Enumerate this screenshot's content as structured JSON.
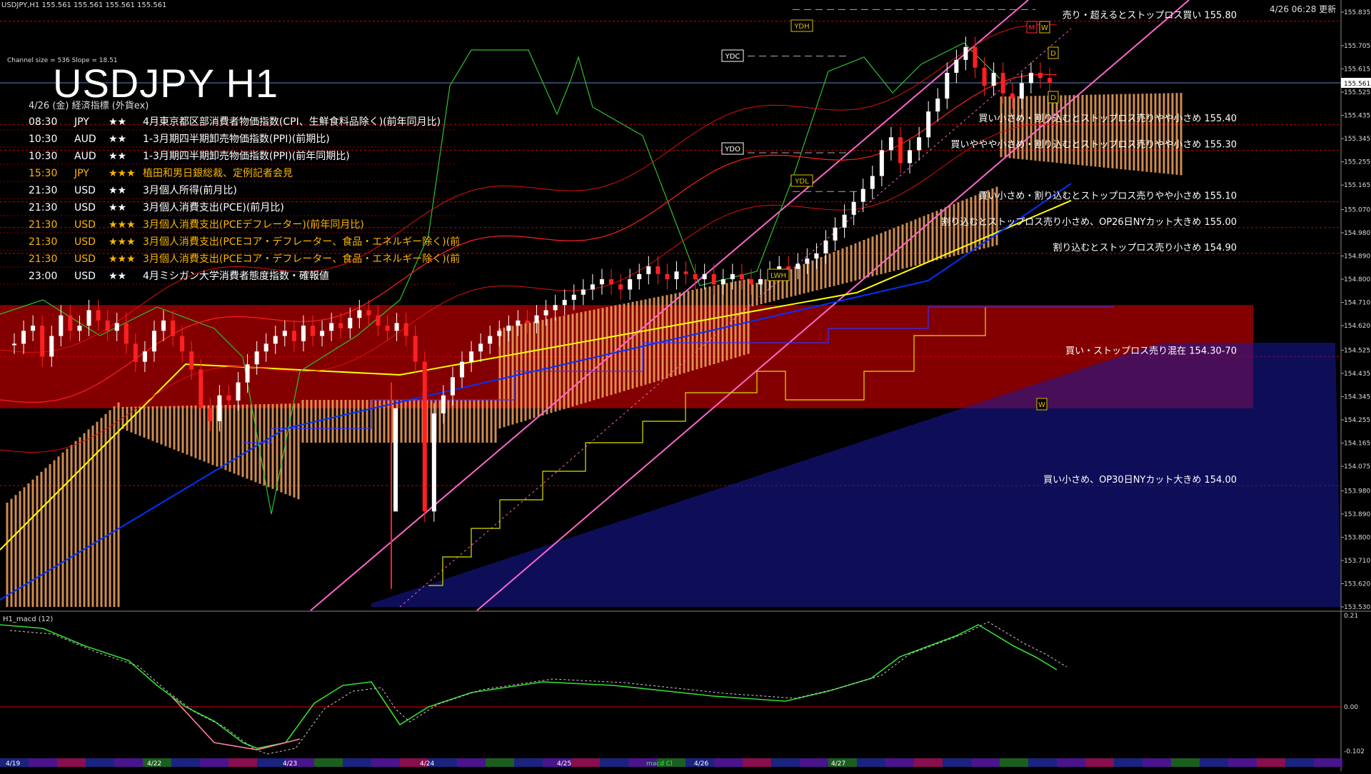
{
  "header": {
    "symbol_line": "USDJPY,H1  155.561 155.561 155.561 155.561",
    "updated": "4/26 06:28 更新"
  },
  "channel_info": "Channel size = 536 Slope = 18.51",
  "title": "USDJPY H1",
  "date_header": "4/26 (金) 経済指標 (外貨ex)",
  "events": [
    {
      "time": "08:30",
      "ccy": "JPY",
      "stars": "★★",
      "text": "4月東京都区部消費者物価指数(CPI、生鮮食料品除く)(前年同月比)",
      "color": "#ffffff"
    },
    {
      "time": "10:30",
      "ccy": "AUD",
      "stars": "★★",
      "text": "1-3月期四半期卸売物価指数(PPI)(前期比)",
      "color": "#ffffff"
    },
    {
      "time": "10:30",
      "ccy": "AUD",
      "stars": "★★",
      "text": "1-3月期四半期卸売物価指数(PPI)(前年同期比)",
      "color": "#ffffff"
    },
    {
      "time": "15:30",
      "ccy": "JPY",
      "stars": "★★★",
      "text": "植田和男日銀総裁、定例記者会見",
      "color": "#ffb400"
    },
    {
      "time": "21:30",
      "ccy": "USD",
      "stars": "★★",
      "text": "3月個人所得(前月比)",
      "color": "#ffffff"
    },
    {
      "time": "21:30",
      "ccy": "USD",
      "stars": "★★",
      "text": "3月個人消費支出(PCE)(前月比)",
      "color": "#ffffff"
    },
    {
      "time": "21:30",
      "ccy": "USD",
      "stars": "★★★",
      "text": "3月個人消費支出(PCEデフレーター)(前年同月比)",
      "color": "#ffb400"
    },
    {
      "time": "21:30",
      "ccy": "USD",
      "stars": "★★★",
      "text": "3月個人消費支出(PCEコア・デフレーター、食品・エネルギー除く)(前",
      "color": "#ffb400"
    },
    {
      "time": "21:30",
      "ccy": "USD",
      "stars": "★★★",
      "text": "3月個人消費支出(PCEコア・デフレーター、食品・エネルギー除く)(前",
      "color": "#ffb400"
    },
    {
      "time": "23:00",
      "ccy": "USD",
      "stars": "★★",
      "text": "4月ミシガン大学消費者態度指数・確報値",
      "color": "#ffffff"
    }
  ],
  "orders": [
    {
      "text": "売り・超えるとストップロス買い 155.80",
      "price": 155.8
    },
    {
      "text": "買い小さめ・割り込むとストップロス売りやや小さめ 155.40",
      "price": 155.4
    },
    {
      "text": "買いややや小さめ・割り込むとストップロス売りやや小さめ 155.30",
      "price": 155.3
    },
    {
      "text": "買い小さめ・割り込むとストップロス売りやや小さめ 155.10",
      "price": 155.1
    },
    {
      "text": "割り込むとストップロス売り小さめ、OP26日NYカット大きめ 155.00",
      "price": 155.0
    },
    {
      "text": "割り込むとストップロス売り小さめ 154.90",
      "price": 154.9
    },
    {
      "text": "買い・ストップロス売り混在 154.30-70",
      "price": 154.5
    },
    {
      "text": "買い小さめ、OP30日NYカット大きめ 154.00",
      "price": 154.0
    }
  ],
  "level_tags": [
    {
      "text": "YDH",
      "price": 155.845
    },
    {
      "text": "YDC",
      "price": 155.665
    },
    {
      "text": "YDO",
      "price": 155.29
    },
    {
      "text": "YDL",
      "price": 155.14
    },
    {
      "text": "LWH",
      "price": 154.83
    },
    {
      "text": "M",
      "price": 155.84
    },
    {
      "text": "W",
      "price": 155.84
    },
    {
      "text": "D",
      "price": 155.665
    },
    {
      "text": "D",
      "price": 155.5
    },
    {
      "text": "W",
      "price": 154.33
    }
  ],
  "current_price": "155.561",
  "macd_label": "H1_macd (12)",
  "macd_legend": "macd Cl",
  "colors": {
    "zone": "#8b0000",
    "upper_line": "#ff66cc",
    "cloud": "#f4a460",
    "cloud_blue": "#1a1aa0",
    "ma_yellow": "#ffff00",
    "ma_blue": "#0033ff"
  },
  "chart_data": {
    "type": "candlestick",
    "title": "USDJPY H1",
    "ylim": [
      153.53,
      155.86
    ],
    "y_ticks": [
      "155.835",
      "155.705",
      "155.615",
      "155.525",
      "155.435",
      "155.345",
      "155.255",
      "155.165",
      "155.070",
      "154.980",
      "154.890",
      "154.800",
      "154.710",
      "154.620",
      "154.525",
      "154.435",
      "154.345",
      "154.255",
      "154.165",
      "154.075",
      "153.980",
      "153.890",
      "153.800",
      "153.710",
      "153.620",
      "153.530"
    ],
    "macd_ylim": [
      -0.102,
      0.21
    ],
    "macd_ticks": [
      "0.21",
      "0.00",
      "-0.102"
    ],
    "x_labels": [
      "4/19",
      "4/22",
      "4/23",
      "4/24",
      "4/25",
      "4/26",
      "4/27"
    ],
    "zone": {
      "low": 154.3,
      "high": 154.7
    },
    "series": [
      {
        "name": "price",
        "values": [
          154.55,
          154.6,
          154.62,
          154.5,
          154.58,
          154.66,
          154.6,
          154.62,
          154.68,
          154.64,
          154.6,
          154.63,
          154.55,
          154.48,
          154.52,
          154.6,
          154.64,
          154.58,
          154.52,
          154.45,
          154.3,
          154.25,
          154.35,
          154.33,
          154.4,
          154.47,
          154.52,
          154.55,
          154.58,
          154.6,
          154.56,
          154.62,
          154.58,
          154.6,
          154.63,
          154.61,
          154.65,
          154.68,
          154.66,
          154.62,
          154.6,
          154.63,
          154.58,
          154.48,
          153.9,
          154.28,
          154.35,
          154.42,
          154.48,
          154.52,
          154.55,
          154.58,
          154.6,
          154.62,
          154.64,
          154.63,
          154.66,
          154.68,
          154.7,
          154.72,
          154.74,
          154.76,
          154.78,
          154.8,
          154.78,
          154.76,
          154.8,
          154.82,
          154.85,
          154.82,
          154.8,
          154.83,
          154.82,
          154.8,
          154.82,
          154.78,
          154.8,
          154.82,
          154.8,
          154.78,
          154.8,
          154.83,
          154.85,
          154.84,
          154.86,
          154.88,
          154.9,
          154.95,
          155.0,
          155.05,
          155.1,
          155.15,
          155.2,
          155.3,
          155.35,
          155.25,
          155.3,
          155.35,
          155.45,
          155.5,
          155.6,
          155.65,
          155.7,
          155.62,
          155.55,
          155.6,
          155.52,
          155.5,
          155.56,
          155.6,
          155.58,
          155.56
        ]
      }
    ]
  }
}
